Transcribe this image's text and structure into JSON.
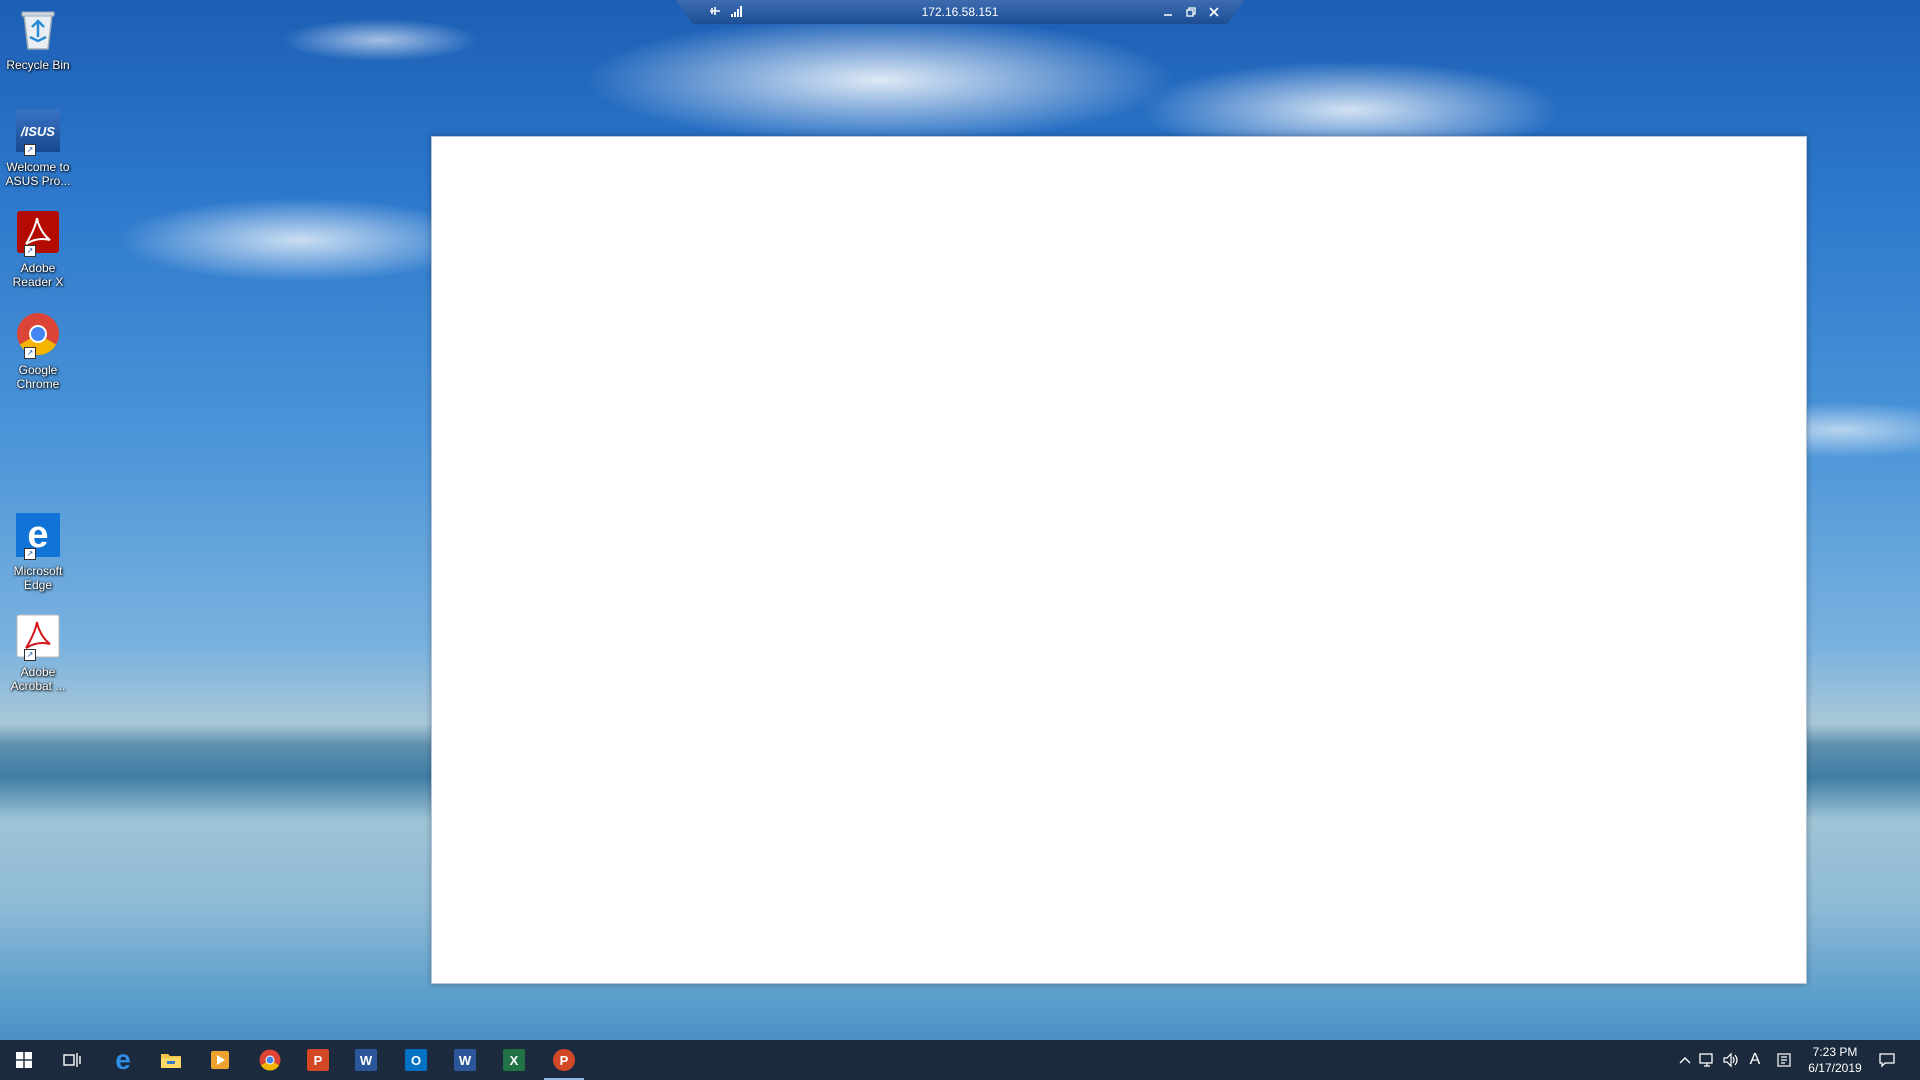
{
  "desktop": {
    "icons": [
      {
        "label": "Recycle Bin",
        "icon": "recycle-bin-icon"
      },
      {
        "label": "Welcome to ASUS Pro...",
        "icon": "asus-logo-icon"
      },
      {
        "label": "Adobe Reader X",
        "icon": "adobe-reader-icon"
      },
      {
        "label": "Google Chrome",
        "icon": "chrome-icon"
      },
      {
        "label": "Microsoft Edge",
        "icon": "edge-icon"
      },
      {
        "label": "Adobe Acrobat ...",
        "icon": "adobe-acrobat-icon"
      }
    ],
    "asus_logo_text": "/ISUS"
  },
  "rdp_bar": {
    "address": "172.16.58.151",
    "pin_icon": "pin-icon",
    "signal_icon": "signal-bars-icon",
    "minimize_icon": "minimize-icon",
    "restore_icon": "restore-icon",
    "close_icon": "close-icon"
  },
  "taskbar": {
    "apps": [
      {
        "name": "start",
        "icon": "windows-logo-icon"
      },
      {
        "name": "task-view",
        "icon": "task-view-icon"
      },
      {
        "name": "edge",
        "icon": "edge-icon"
      },
      {
        "name": "file-explorer",
        "icon": "folder-icon"
      },
      {
        "name": "media-player",
        "icon": "media-player-icon"
      },
      {
        "name": "chrome",
        "icon": "chrome-icon"
      },
      {
        "name": "publisher",
        "icon": "publisher-icon",
        "letter": "P"
      },
      {
        "name": "word-old",
        "icon": "word-icon",
        "letter": "W"
      },
      {
        "name": "outlook",
        "icon": "outlook-icon",
        "letter": "O"
      },
      {
        "name": "word",
        "icon": "word-icon",
        "letter": "W"
      },
      {
        "name": "excel",
        "icon": "excel-icon",
        "letter": "X"
      },
      {
        "name": "powerpoint",
        "icon": "powerpoint-icon",
        "letter": "P"
      }
    ],
    "ime_label": "A",
    "time": "7:23 PM",
    "date": "6/17/2019"
  },
  "colors": {
    "taskbar": "#1b2a3c",
    "rdp_bar": "#1d4d94",
    "publisher": "#d24726",
    "word": "#2b579a",
    "outlook": "#0072c6",
    "excel": "#217346",
    "powerpoint": "#d24726"
  }
}
